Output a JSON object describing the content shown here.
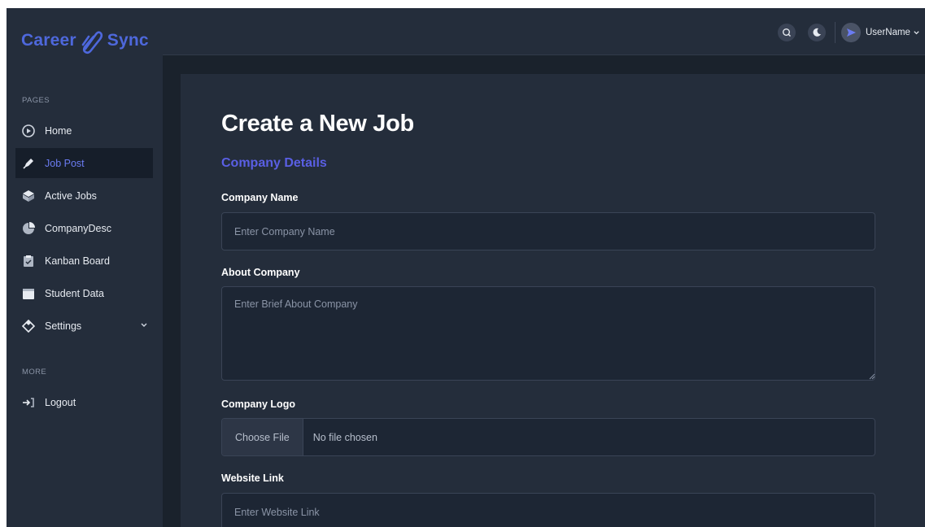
{
  "brand": {
    "part1": "Career",
    "part2": "Sync"
  },
  "sidebar": {
    "pages_title": "PAGES",
    "more_title": "MORE",
    "items": [
      {
        "label": "Home",
        "icon": "home-icon"
      },
      {
        "label": "Job Post",
        "icon": "pen-icon",
        "active": true
      },
      {
        "label": "Active Jobs",
        "icon": "cube-icon"
      },
      {
        "label": "CompanyDesc",
        "icon": "pie-chart-icon"
      },
      {
        "label": "Kanban Board",
        "icon": "clipboard-check-icon"
      },
      {
        "label": "Student Data",
        "icon": "calendar-icon"
      },
      {
        "label": "Settings",
        "icon": "diamond-icon",
        "has_submenu": true
      }
    ],
    "more_items": [
      {
        "label": "Logout",
        "icon": "logout-icon"
      }
    ]
  },
  "topbar": {
    "user_name": "UserName",
    "icons": [
      "search-icon",
      "moon-icon",
      "user-avatar-icon"
    ]
  },
  "form": {
    "title": "Create a New Job",
    "section": "Company Details",
    "company_name_label": "Company Name",
    "company_name_placeholder": "Enter Company Name",
    "about_label": "About Company",
    "about_placeholder": "Enter Brief About Company",
    "logo_label": "Company Logo",
    "file_button": "Choose File",
    "file_status": "No file chosen",
    "website_label": "Website Link",
    "website_placeholder": "Enter Website Link"
  },
  "colors": {
    "accent": "#5a5fe4",
    "brand": "#4e68dc",
    "sidebar_bg": "#242d3b",
    "page_bg": "#1a222c",
    "active_text": "#6b7cf2"
  }
}
